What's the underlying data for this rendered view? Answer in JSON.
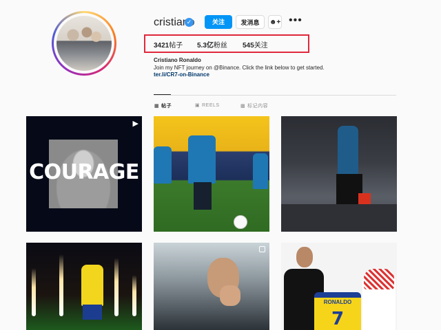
{
  "profile": {
    "username": "cristiano",
    "verified_icon": "✓",
    "follow_button": "关注",
    "message_button": "发消息",
    "suggest_icon": "person-add-icon",
    "more_icon": "•••",
    "stats": {
      "posts": "3421",
      "posts_label": "帖子",
      "followers": "5.3亿",
      "followers_label": "粉丝",
      "following": "545",
      "following_label": "关注"
    },
    "full_name": "Cristiano Ronaldo",
    "bio": "Join my NFT journey on @Binance. Click the link below to get started.",
    "link": "ter.li/CR7-on-Binance"
  },
  "tabs": [
    {
      "label": "帖子",
      "icon": "grid-icon",
      "active": true
    },
    {
      "label": "REELS",
      "icon": "reels-icon",
      "active": false
    },
    {
      "label": "标记内容",
      "icon": "tagged-icon",
      "active": false
    }
  ],
  "posts": [
    {
      "overlay_text": "COURAGE",
      "badge": "reel"
    },
    {
      "badge": "none"
    },
    {
      "badge": "none"
    },
    {
      "badge": "none"
    },
    {
      "badge": "carousel"
    },
    {
      "jersey_name": "RONALDO",
      "jersey_number": "7",
      "badge": "none"
    }
  ],
  "colors": {
    "follow_button": "#0095f6",
    "highlight_box": "#e0273a",
    "link": "#00376b"
  }
}
